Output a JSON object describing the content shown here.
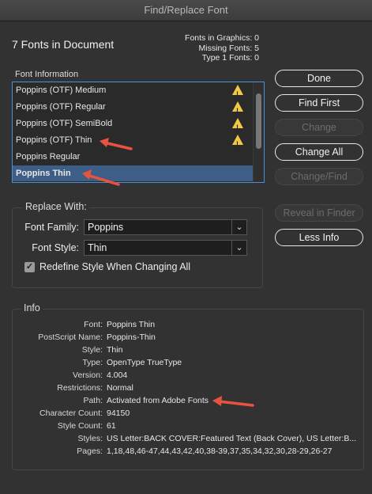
{
  "window": {
    "title": "Find/Replace Font"
  },
  "summary": {
    "title": "7 Fonts in Document",
    "stats": [
      "Fonts in Graphics: 0",
      "Missing Fonts: 5",
      "Type 1 Fonts: 0"
    ]
  },
  "font_info": {
    "label": "Font Information",
    "fonts": [
      {
        "name": "Poppins (OTF) Medium",
        "warning": true
      },
      {
        "name": "Poppins (OTF) Regular",
        "warning": true
      },
      {
        "name": "Poppins (OTF) SemiBold",
        "warning": true
      },
      {
        "name": "Poppins (OTF) Thin",
        "warning": true
      },
      {
        "name": "Poppins Regular",
        "warning": false
      },
      {
        "name": "Poppins Thin",
        "warning": false,
        "selected": true
      }
    ]
  },
  "buttons": {
    "done": "Done",
    "find_first": "Find First",
    "change": "Change",
    "change_all": "Change All",
    "change_find": "Change/Find",
    "reveal": "Reveal in Finder",
    "less_info": "Less Info"
  },
  "replace": {
    "label": "Replace With:",
    "family_label": "Font Family:",
    "family_value": "Poppins",
    "style_label": "Font Style:",
    "style_value": "Thin",
    "redefine_label": "Redefine Style When Changing All",
    "redefine_checked": true
  },
  "info": {
    "label": "Info",
    "rows": [
      {
        "key": "Font:",
        "value": "Poppins Thin"
      },
      {
        "key": "PostScript Name:",
        "value": "Poppins-Thin"
      },
      {
        "key": "Style:",
        "value": "Thin"
      },
      {
        "key": "Type:",
        "value": "OpenType TrueType"
      },
      {
        "key": "Version:",
        "value": "4.004"
      },
      {
        "key": "Restrictions:",
        "value": "Normal"
      },
      {
        "key": "Path:",
        "value": "Activated from Adobe Fonts"
      },
      {
        "key": "Character Count:",
        "value": "94150"
      },
      {
        "key": "Style Count:",
        "value": "61"
      },
      {
        "key": "Styles:",
        "value": "US Letter:BACK COVER:Featured Text (Back Cover), US Letter:B..."
      },
      {
        "key": "Pages:",
        "value": "1,18,48,46-47,44,43,42,40,38-39,37,35,34,32,30,28-29,26-27"
      }
    ]
  },
  "colors": {
    "background": "#323232",
    "selection": "#3d5e87",
    "focus_border": "#4a90d9",
    "warning": "#f2c744",
    "annotation_arrow": "#e8533f"
  }
}
